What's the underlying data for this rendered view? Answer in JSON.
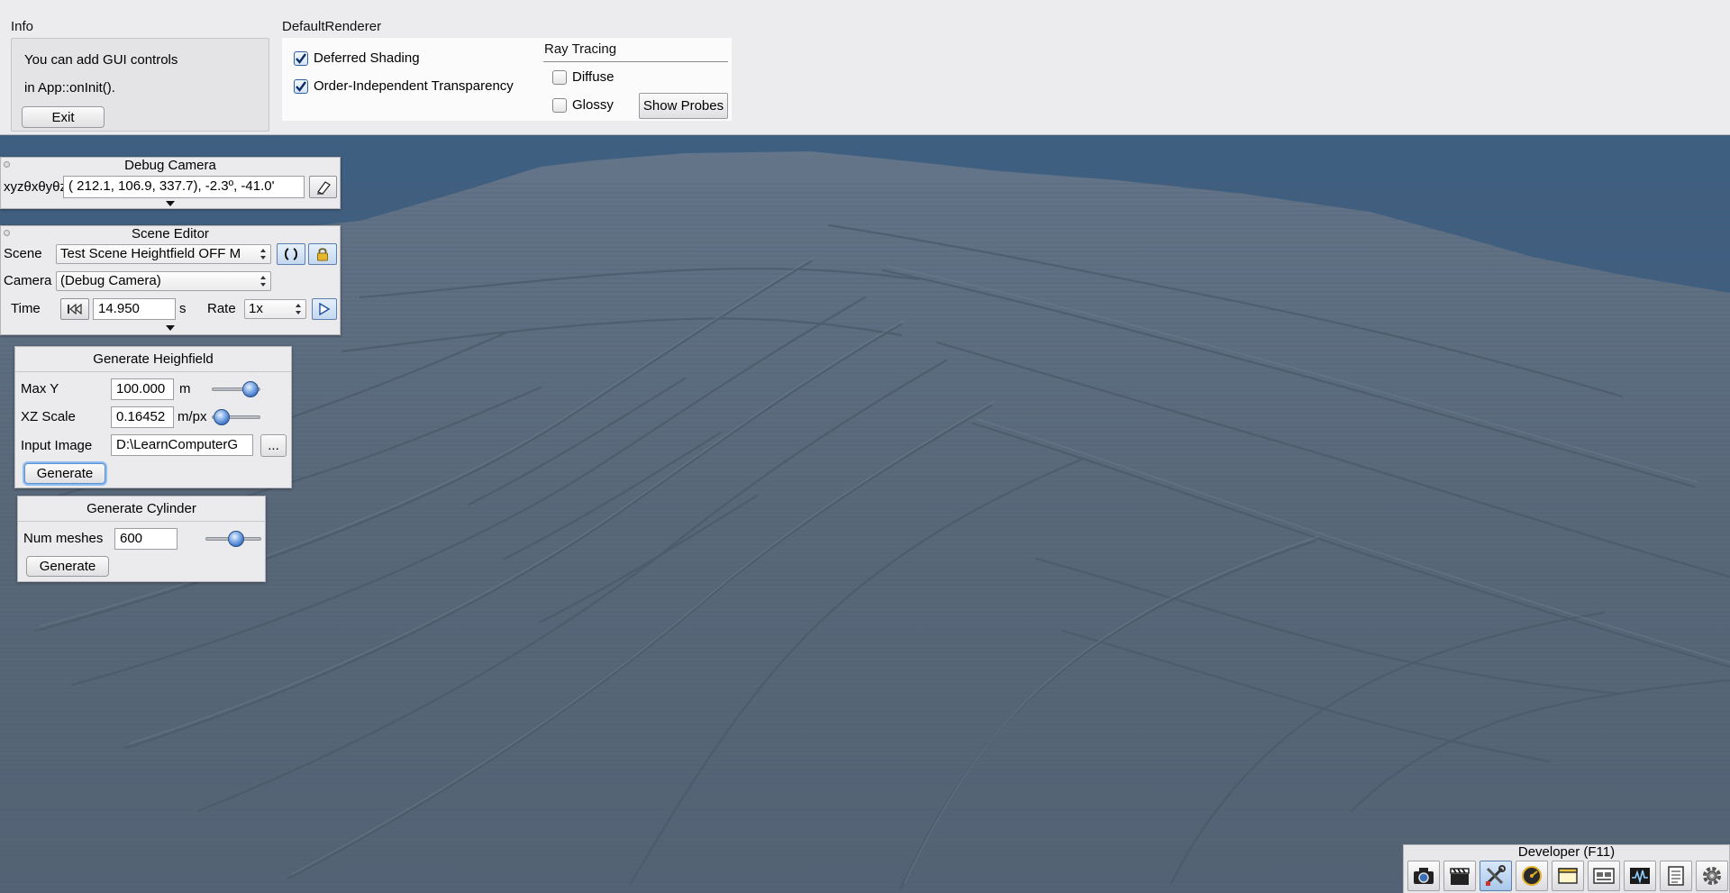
{
  "info": {
    "caption": "Info",
    "line1": "You can add GUI controls",
    "line2": "in App::onInit().",
    "exit_label": "Exit"
  },
  "renderer": {
    "caption": "DefaultRenderer",
    "deferred_shading": {
      "label": "Deferred Shading",
      "checked": true
    },
    "oit": {
      "label": "Order-Independent Transparency",
      "checked": true
    },
    "ray_tracing": {
      "title": "Ray Tracing",
      "diffuse": {
        "label": "Diffuse",
        "checked": false
      },
      "glossy": {
        "label": "Glossy",
        "checked": false
      },
      "show_probes_label": "Show Probes"
    }
  },
  "debug_camera": {
    "title": "Debug Camera",
    "coord_label": "xyzθxθyθz",
    "coord_value": "( 212.1,  106.9,  337.7),  -2.3º, -41.0'"
  },
  "scene_editor": {
    "title": "Scene Editor",
    "scene_label": "Scene",
    "scene_value": "Test Scene Heightfield OFF M",
    "camera_label": "Camera",
    "camera_value": "(Debug Camera)",
    "time_label": "Time",
    "time_value": "14.950",
    "time_unit": "s",
    "rate_label": "Rate",
    "rate_value": "1x"
  },
  "heightfield": {
    "title": "Generate Heighfield",
    "max_y_label": "Max Y",
    "max_y_value": "100.000",
    "max_y_unit": "m",
    "max_y_slider": 0.8,
    "xz_label": "XZ Scale",
    "xz_value": "0.16452",
    "xz_unit": "m/px",
    "xz_slider": 0.2,
    "input_label": "Input Image",
    "input_value": "D:\\LearnComputerG",
    "browse_label": "...",
    "generate_label": "Generate"
  },
  "cylinder": {
    "title": "Generate Cylinder",
    "num_label": "Num meshes",
    "num_value": "600",
    "num_slider": 0.55,
    "generate_label": "Generate"
  },
  "developer": {
    "title": "Developer (F11)",
    "tools": [
      "camera-icon",
      "film-clapper-icon",
      "wrench-screwdriver-icon",
      "speedometer-icon",
      "window-icon",
      "scene-graph-icon",
      "profiler-icon",
      "log-icon",
      "gear-icon"
    ],
    "active_tool": "wrench-screwdriver-icon"
  },
  "colors": {
    "sky": "#3f5f80",
    "terrain": "#56667a",
    "accent": "#2f67c0"
  }
}
